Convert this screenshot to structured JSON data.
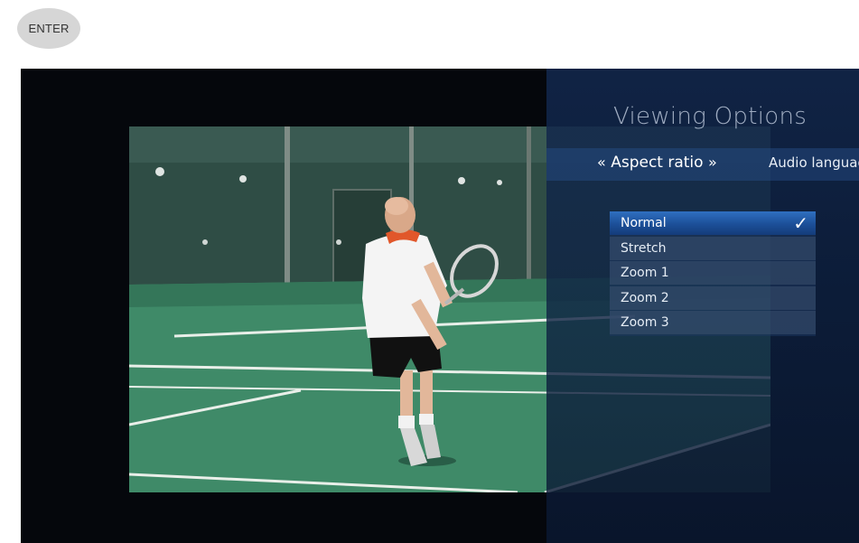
{
  "enter_button": {
    "label": "ENTER"
  },
  "panel": {
    "title": "Viewing Options",
    "tabs": {
      "prev_chevron": "«",
      "active_label": "Aspect ratio",
      "next_chevron": "»",
      "next_label": "Audio language"
    },
    "options": [
      {
        "label": "Normal",
        "selected": true
      },
      {
        "label": "Stretch",
        "selected": false
      },
      {
        "label": "Zoom 1",
        "selected": false
      },
      {
        "label": "Zoom 2",
        "selected": false
      },
      {
        "label": "Zoom 3",
        "selected": false
      }
    ],
    "check_icon": "✓"
  },
  "colors": {
    "selection": "#1c4f98",
    "court": "#3f8a68",
    "fence": "#2f4d45"
  }
}
